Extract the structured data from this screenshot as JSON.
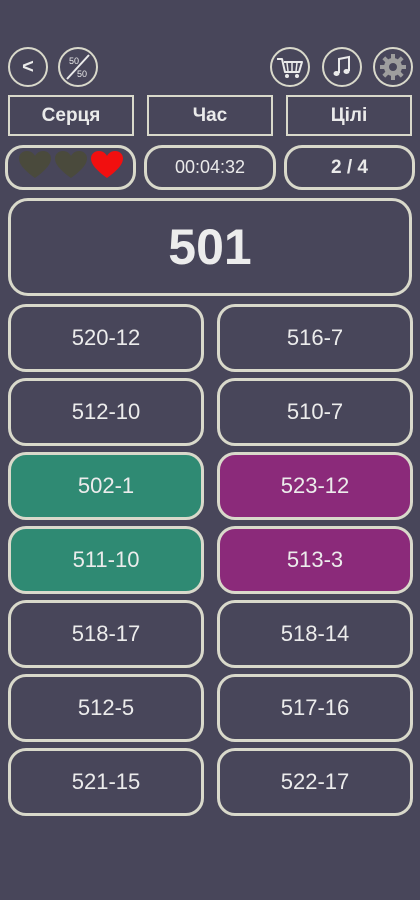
{
  "toolbar": {
    "back_label": "<",
    "fifty_top": "50",
    "fifty_bottom": "50",
    "basket_icon": "basket-icon",
    "music_icon": "music-note-icon",
    "settings_icon": "gear-icon"
  },
  "headers": {
    "hearts": "Серця",
    "time": "Час",
    "goals": "Цілі"
  },
  "status": {
    "hearts_total": 3,
    "hearts_remaining": 1,
    "timer": "00:04:32",
    "goals": "2 / 4"
  },
  "target": "501",
  "colors": {
    "background": "#48465a",
    "border": "#d9d9cb",
    "correct": "#2f8a73",
    "wrong": "#8b2a7a",
    "heart_full": "#f20f0f",
    "heart_empty": "#4a4a3c"
  },
  "options": [
    {
      "label": "520-12",
      "state": "normal"
    },
    {
      "label": "516-7",
      "state": "normal"
    },
    {
      "label": "512-10",
      "state": "normal"
    },
    {
      "label": "510-7",
      "state": "normal"
    },
    {
      "label": "502-1",
      "state": "correct"
    },
    {
      "label": "523-12",
      "state": "wrong"
    },
    {
      "label": "511-10",
      "state": "correct"
    },
    {
      "label": "513-3",
      "state": "wrong"
    },
    {
      "label": "518-17",
      "state": "normal"
    },
    {
      "label": "518-14",
      "state": "normal"
    },
    {
      "label": "512-5",
      "state": "normal"
    },
    {
      "label": "517-16",
      "state": "normal"
    },
    {
      "label": "521-15",
      "state": "normal"
    },
    {
      "label": "522-17",
      "state": "normal"
    }
  ]
}
